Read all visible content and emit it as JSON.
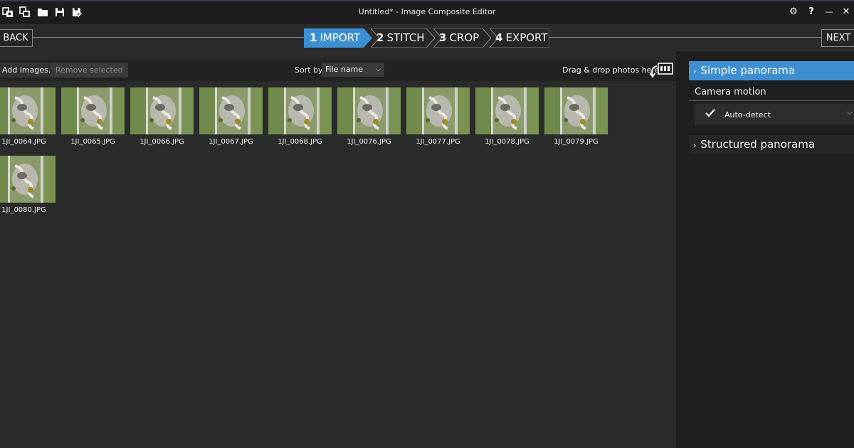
{
  "window": {
    "title": "Untitled* - Image Composite Editor",
    "toolbar_icons": [
      "new-panorama-icon",
      "new-video-panorama-icon",
      "open-folder-icon",
      "save-icon",
      "save-as-icon"
    ],
    "controls": {
      "settings": "⚙",
      "help": "?",
      "minimize": "—",
      "close": "✕"
    }
  },
  "wizard": {
    "back_label": "BACK",
    "next_label": "NEXT",
    "active_step": 1,
    "steps": [
      {
        "num": "1",
        "label": "IMPORT"
      },
      {
        "num": "2",
        "label": "STITCH"
      },
      {
        "num": "3",
        "label": "CROP"
      },
      {
        "num": "4",
        "label": "EXPORT"
      }
    ],
    "accent_color": "#3d8fd1"
  },
  "toolbar": {
    "add_images_label": "Add images...",
    "remove_selected_label": "Remove selected",
    "remove_selected_enabled": false,
    "sort_label": "Sort by",
    "sort_value": "File name",
    "drag_drop_label": "Drag & drop photos here"
  },
  "images": [
    {
      "name": "1JI_0064.JPG"
    },
    {
      "name": "1JI_0065.JPG"
    },
    {
      "name": "1JI_0066.JPG"
    },
    {
      "name": "1JI_0067.JPG"
    },
    {
      "name": "1JI_0068.JPG"
    },
    {
      "name": "1JI_0076.JPG"
    },
    {
      "name": "1JI_0077.JPG"
    },
    {
      "name": "1JI_0078.JPG"
    },
    {
      "name": "1JI_0079.JPG"
    },
    {
      "name": "1JI_0080.JPG"
    }
  ],
  "panel": {
    "simple_label": "Simple panorama",
    "camera_motion_label": "Camera motion",
    "camera_motion_value": "Auto-detect",
    "structured_label": "Structured panorama"
  }
}
